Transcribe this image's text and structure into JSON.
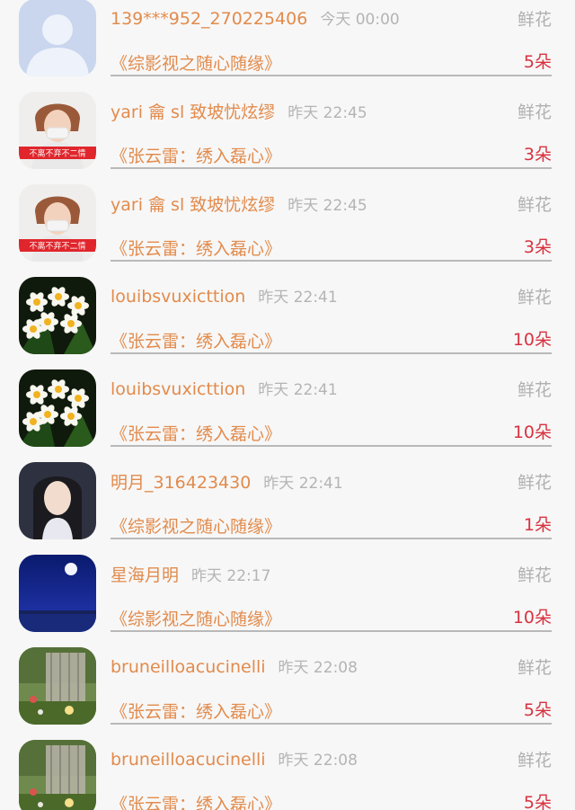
{
  "items": [
    {
      "name": "139***952_270225406",
      "time": "今天 00:00",
      "gift": "鲜花",
      "work": "《综影视之随心随缘》",
      "count": "5朵",
      "avatar": "default-avatar"
    },
    {
      "name": "yari 龠 sl 致坡忧炫缪",
      "time": "昨天 22:45",
      "gift": "鲜花",
      "work": "《张云雷：绣入磊心》",
      "count": "3朵",
      "avatar": "person-masked-avatar",
      "avatar_caption": "不离不弃不二情"
    },
    {
      "name": "yari 龠 sl 致坡忧炫缪",
      "time": "昨天 22:45",
      "gift": "鲜花",
      "work": "《张云雷：绣入磊心》",
      "count": "3朵",
      "avatar": "person-masked-avatar",
      "avatar_caption": "不离不弃不二情"
    },
    {
      "name": "louibsvuxicttion",
      "time": "昨天 22:41",
      "gift": "鲜花",
      "work": "《张云雷：绣入磊心》",
      "count": "10朵",
      "avatar": "daffodil-avatar"
    },
    {
      "name": "louibsvuxicttion",
      "time": "昨天 22:41",
      "gift": "鲜花",
      "work": "《张云雷：绣入磊心》",
      "count": "10朵",
      "avatar": "daffodil-avatar"
    },
    {
      "name": "明月_316423430",
      "time": "昨天 22:41",
      "gift": "鲜花",
      "work": "《综影视之随心随缘》",
      "count": "1朵",
      "avatar": "girl-portrait-avatar"
    },
    {
      "name": "星海月明",
      "time": "昨天 22:17",
      "gift": "鲜花",
      "work": "《综影视之随心随缘》",
      "count": "10朵",
      "avatar": "moon-night-avatar"
    },
    {
      "name": "bruneilloacucinelli",
      "time": "昨天 22:08",
      "gift": "鲜花",
      "work": "《张云雷：绣入磊心》",
      "count": "5朵",
      "avatar": "garden-gate-avatar"
    },
    {
      "name": "bruneilloacucinelli",
      "time": "昨天 22:08",
      "gift": "鲜花",
      "work": "《张云雷：绣入磊心》",
      "count": "5朵",
      "avatar": "garden-gate-avatar"
    }
  ],
  "colors": {
    "name": "#e28b4c",
    "count": "#d8323f",
    "time": "#b4b4b4",
    "gift": "#b0b0b0"
  }
}
